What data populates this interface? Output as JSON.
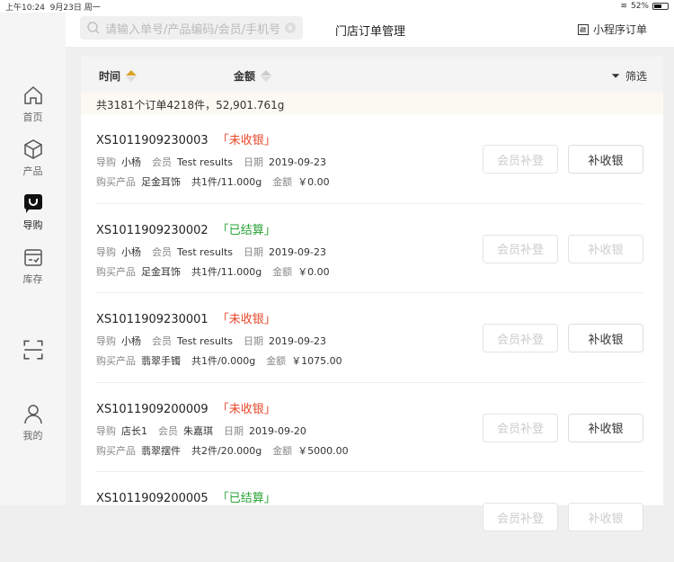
{
  "status": {
    "time": "上午10:24",
    "date": "9月23日 周一",
    "battery": "52%",
    "battery_level": 0.52
  },
  "sidebar": {
    "items": [
      {
        "label": "首页"
      },
      {
        "label": "产品"
      },
      {
        "label": "导购"
      },
      {
        "label": "库存"
      },
      {
        "label": ""
      },
      {
        "label": "我的"
      }
    ]
  },
  "header": {
    "search_placeholder": "请输入单号/产品编码/会员/手机号",
    "title": "门店订单管理",
    "mini_orders": "小程序订单"
  },
  "filter": {
    "time": "时间",
    "amount": "金额",
    "filter": "筛选"
  },
  "summary": "共3181个订单4218件，52,901.761g",
  "labels": {
    "guide": "导购",
    "member": "会员",
    "date": "日期",
    "product": "购买产品",
    "amount": "金额",
    "btn_member": "会员补登",
    "btn_cash": "补收银"
  },
  "orders": [
    {
      "id": "XS1011909230003",
      "status": "「未收银」",
      "status_color": "red",
      "guide": "小杨",
      "member": "Test results",
      "date": "2019-09-23",
      "product": "足金耳饰",
      "qty": "共1件/11.000g",
      "amount": "￥0.00",
      "cash_enabled": true
    },
    {
      "id": "XS1011909230002",
      "status": "「已结算」",
      "status_color": "green",
      "guide": "小杨",
      "member": "Test results",
      "date": "2019-09-23",
      "product": "足金耳饰",
      "qty": "共1件/11.000g",
      "amount": "￥0.00",
      "cash_enabled": false
    },
    {
      "id": "XS1011909230001",
      "status": "「未收银」",
      "status_color": "red",
      "guide": "小杨",
      "member": "Test results",
      "date": "2019-09-23",
      "product": "翡翠手镯",
      "qty": "共1件/0.000g",
      "amount": "￥1075.00",
      "cash_enabled": true
    },
    {
      "id": "XS1011909200009",
      "status": "「未收银」",
      "status_color": "red",
      "guide": "店长1",
      "member": "朱嘉琪",
      "date": "2019-09-20",
      "product": "翡翠摆件",
      "qty": "共2件/20.000g",
      "amount": "￥5000.00",
      "cash_enabled": true
    },
    {
      "id": "XS1011909200005",
      "status": "「已结算」",
      "status_color": "green"
    }
  ]
}
